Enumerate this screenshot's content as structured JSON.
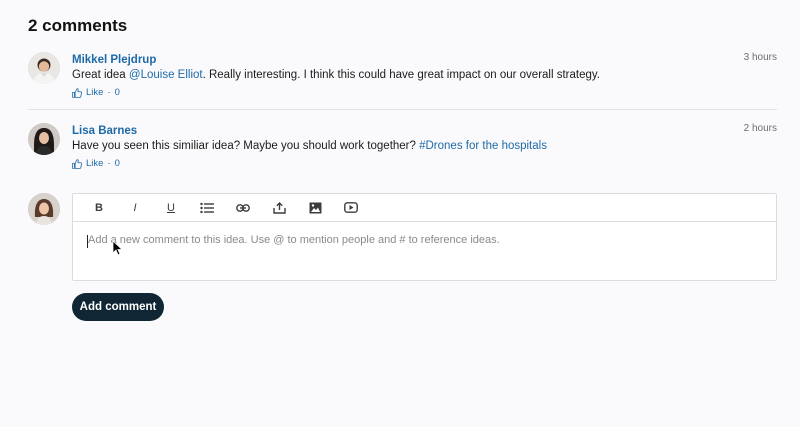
{
  "header": {
    "title": "2 comments"
  },
  "comments": [
    {
      "author": "Mikkel Plejdrup",
      "time": "3 hours",
      "text_before": "Great idea ",
      "mention": "@Louise Elliot",
      "text_after": ". Really interesting. I think this could have great impact on our overall strategy.",
      "like_label": "Like",
      "separator": "·",
      "like_count": "0"
    },
    {
      "author": "Lisa Barnes",
      "time": "2 hours",
      "text_before": "Have you seen this similiar idea? Maybe you should work together? ",
      "mention": "#Drones for the hospitals",
      "text_after": "",
      "like_label": "Like",
      "separator": "·",
      "like_count": "0"
    }
  ],
  "editor": {
    "toolbar": {
      "bold": "B",
      "italic": "I",
      "underline": "U",
      "icons": [
        "bulleted-list-icon",
        "link-icon",
        "upload-icon",
        "image-icon",
        "video-icon"
      ]
    },
    "placeholder": "Add a new comment to this idea. Use @ to mention people and # to reference ideas.",
    "submit_label": "Add comment"
  },
  "colors": {
    "link": "#1e6aa8",
    "button_bg": "#102634",
    "background": "#fafafc"
  }
}
